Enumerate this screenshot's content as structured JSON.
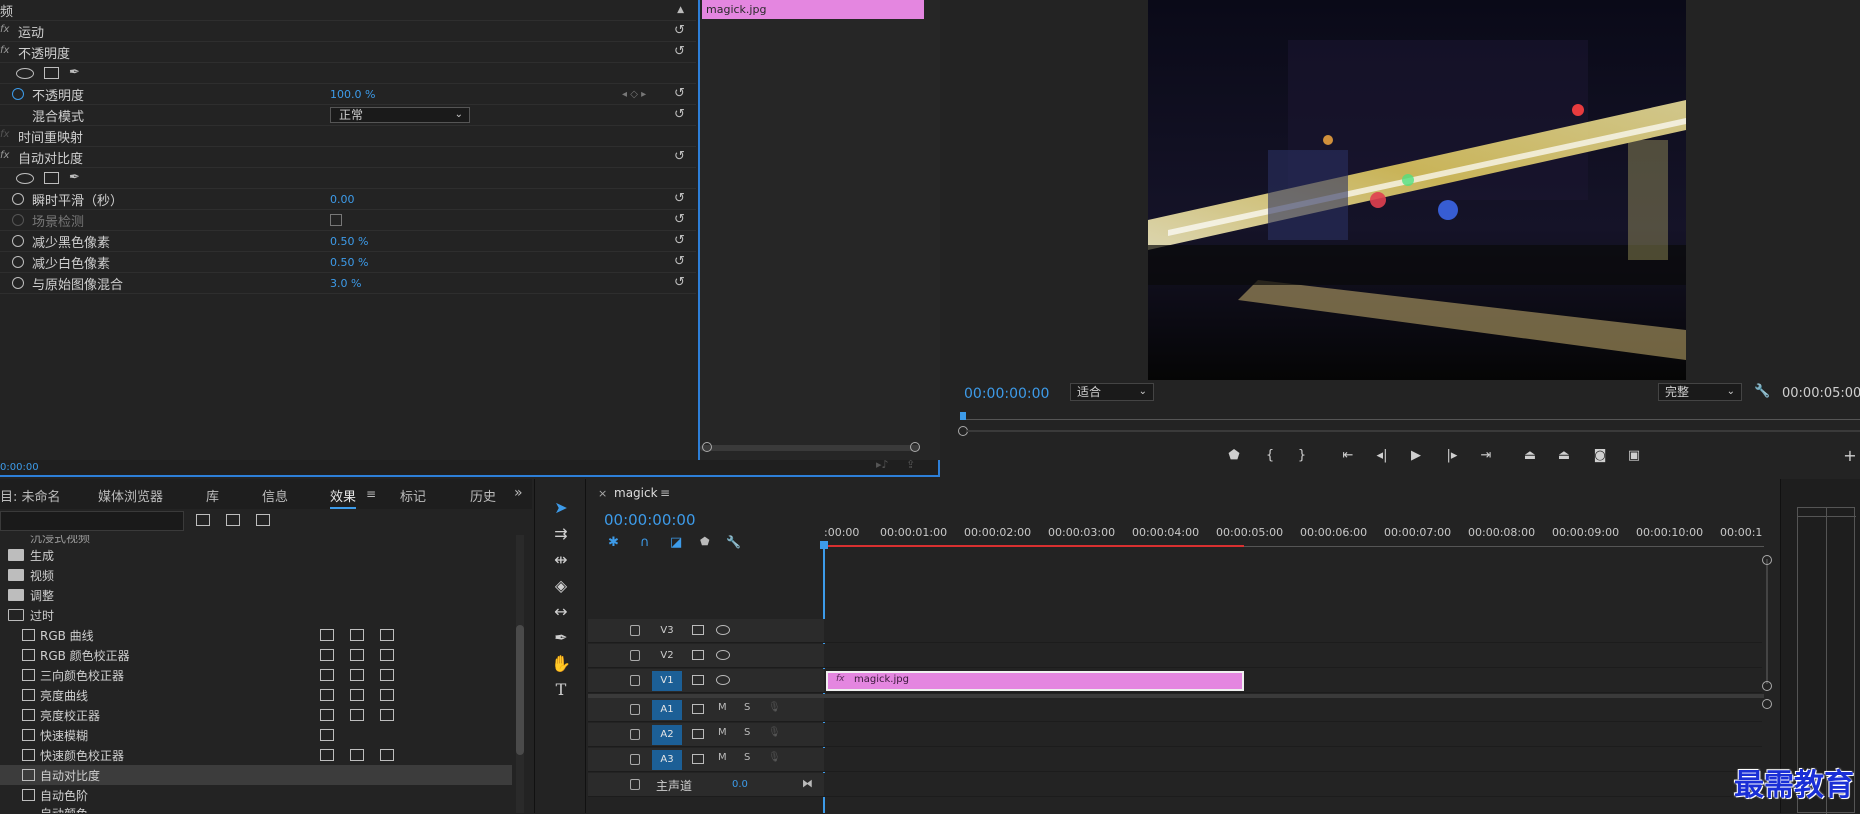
{
  "effect_controls": {
    "section_title": "频",
    "rows": {
      "motion": "运动",
      "opacity_group": "不透明度",
      "opacity": "不透明度",
      "opacity_value": "100.0 %",
      "blend_mode": "混合模式",
      "blend_value": "正常",
      "time_remap": "时间重映射",
      "auto_contrast": "自动对比度",
      "temporal_smoothing": "瞬时平滑（秒）",
      "temporal_smoothing_value": "0.00",
      "scene_detect": "场景检测",
      "reduce_black": "减少黑色像素",
      "reduce_black_value": "0.50 %",
      "reduce_white": "减少白色像素",
      "reduce_white_value": "0.50 %",
      "blend_original": "与原始图像混合",
      "blend_original_value": "3.0 %"
    },
    "clip_name": "magick.jpg",
    "bottom_timecode": "0:00:00"
  },
  "program_monitor": {
    "timecode": "00:00:00:00",
    "zoom_select": "适合",
    "quality_select": "完整",
    "duration": "00:00:05:00"
  },
  "effects_panel": {
    "tabs": {
      "project": "目: 未命名",
      "media_browser": "媒体浏览器",
      "library": "库",
      "info": "信息",
      "effects": "效果",
      "markers": "标记",
      "history": "历史"
    },
    "items": {
      "partial": "沉浸式视频",
      "generate": "生成",
      "video": "视频",
      "adjust": "调整",
      "obsolete": "过时",
      "rgb_curves": "RGB 曲线",
      "rgb_corrector": "RGB 颜色校正器",
      "three_way": "三向颜色校正器",
      "luma_curve": "亮度曲线",
      "luma_corrector": "亮度校正器",
      "fast_blur": "快速模糊",
      "fast_color": "快速颜色校正器",
      "auto_contrast": "自动对比度",
      "auto_levels": "自动色阶",
      "auto_color": "自动颜色"
    }
  },
  "timeline": {
    "tab_name": "magick",
    "timecode": "00:00:00:00",
    "ruler": [
      ":00:00",
      "00:00:01:00",
      "00:00:02:00",
      "00:00:03:00",
      "00:00:04:00",
      "00:00:05:00",
      "00:00:06:00",
      "00:00:07:00",
      "00:00:08:00",
      "00:00:09:00",
      "00:00:10:00",
      "00:00:1"
    ],
    "tracks": {
      "v3": "V3",
      "v2": "V2",
      "v1": "V1",
      "a1": "A1",
      "a2": "A2",
      "a3": "A3",
      "m": "M",
      "s": "S",
      "master": "主声道",
      "master_value": "0.0"
    },
    "clip_label": "magick.jpg"
  },
  "watermark": "最需教育",
  "colors": {
    "accent": "#3d9be9",
    "clip": "#e486e0",
    "track_selected": "#1c5f96"
  }
}
